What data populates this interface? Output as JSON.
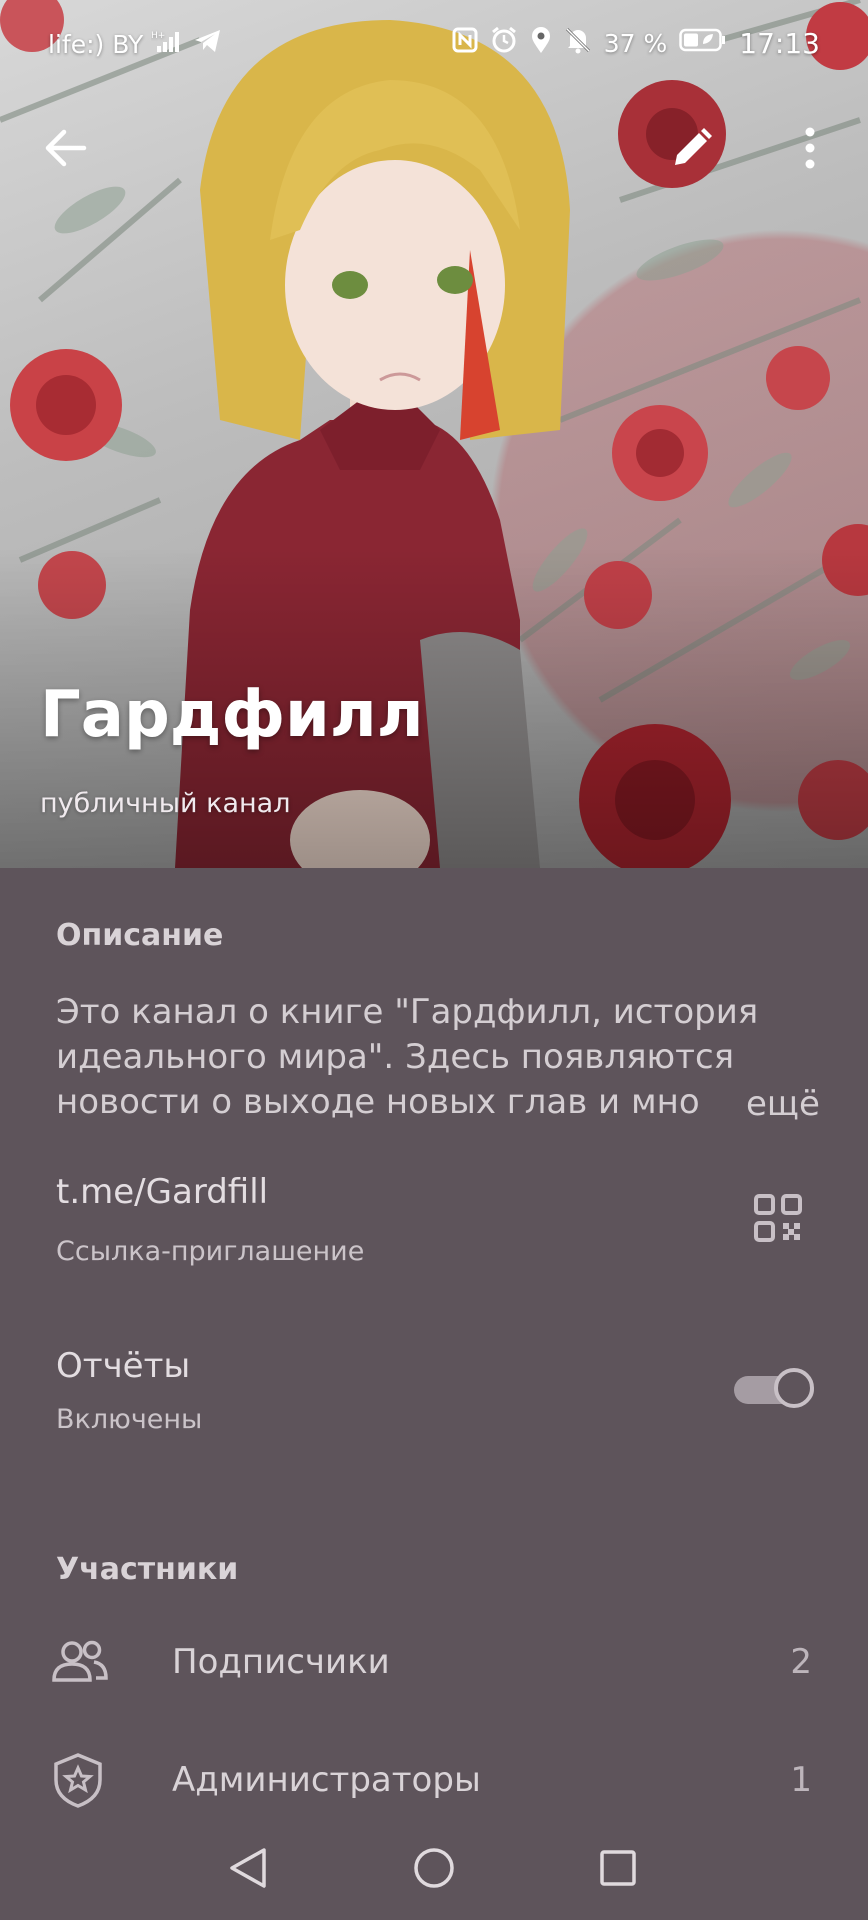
{
  "status_bar": {
    "carrier": "life:) BY",
    "battery": "37 %",
    "time": "17:13",
    "icons": [
      "signal-icon",
      "telegram-icon",
      "nfc-icon",
      "alarm-icon",
      "location-icon",
      "mute-icon",
      "battery-icon"
    ]
  },
  "header": {
    "title": "Гардфилл",
    "subtitle": "публичный канал",
    "icons": [
      "back-arrow-icon",
      "edit-pencil-icon",
      "more-vert-icon"
    ]
  },
  "description": {
    "section_title": "Описание",
    "text": "Это канал о книге \"Гардфилл, история идеального мира\". Здесь появляются новости о выходе новых глав и мно",
    "more_label": "ещё"
  },
  "invite_link": {
    "value": "t.me/Gardfill",
    "label": "Ссылка-приглашение",
    "icon": "qr-code-icon"
  },
  "reports": {
    "title": "Отчёты",
    "status": "Включены",
    "enabled": true
  },
  "members": {
    "section_title": "Участники",
    "rows": [
      {
        "label": "Подписчики",
        "count": "2",
        "icon": "people-icon"
      },
      {
        "label": "Администраторы",
        "count": "1",
        "icon": "shield-star-icon"
      }
    ]
  },
  "nav_bar": {
    "icons": [
      "nav-back-icon",
      "nav-home-icon",
      "nav-recent-icon"
    ]
  },
  "colors": {
    "background": "#5e545b",
    "text_primary": "#e3dde1",
    "text_secondary": "#cbc4c9",
    "accent_rose": "#c0393f",
    "dress": "#8a2633",
    "hair": "#d9b64a"
  }
}
